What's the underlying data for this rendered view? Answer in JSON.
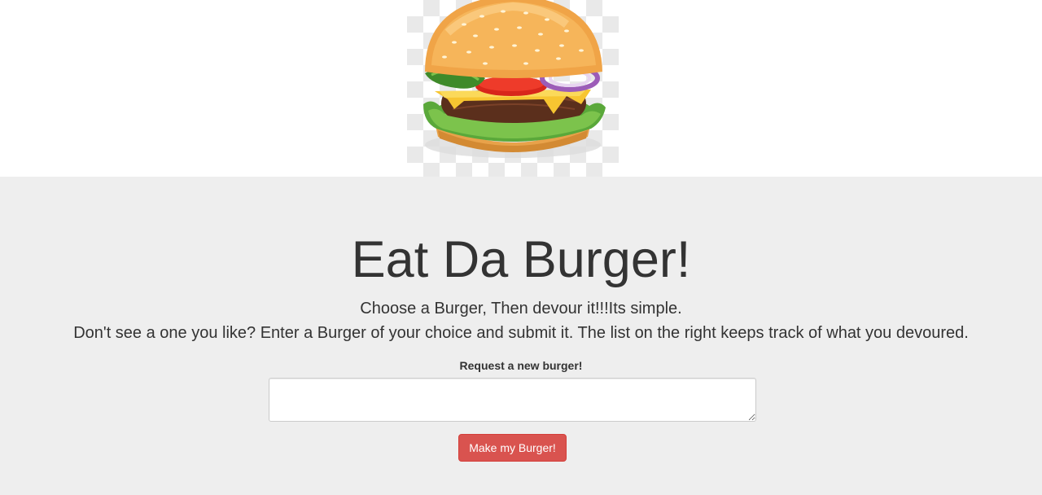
{
  "header": {
    "image": "burger-image"
  },
  "jumbotron": {
    "title": "Eat Da Burger!",
    "subtitle_line1": "Choose a Burger, Then devour it!!!Its simple.",
    "subtitle_line2": "Don't see a one you like? Enter a Burger of your choice and submit it. The list on the right keeps track of what you devoured."
  },
  "form": {
    "label": "Request a new burger!",
    "input_value": "",
    "submit_label": "Make my Burger!"
  },
  "colors": {
    "jumbotron_background": "#eeeeee",
    "button_background": "#d9534f",
    "text": "#333333"
  }
}
